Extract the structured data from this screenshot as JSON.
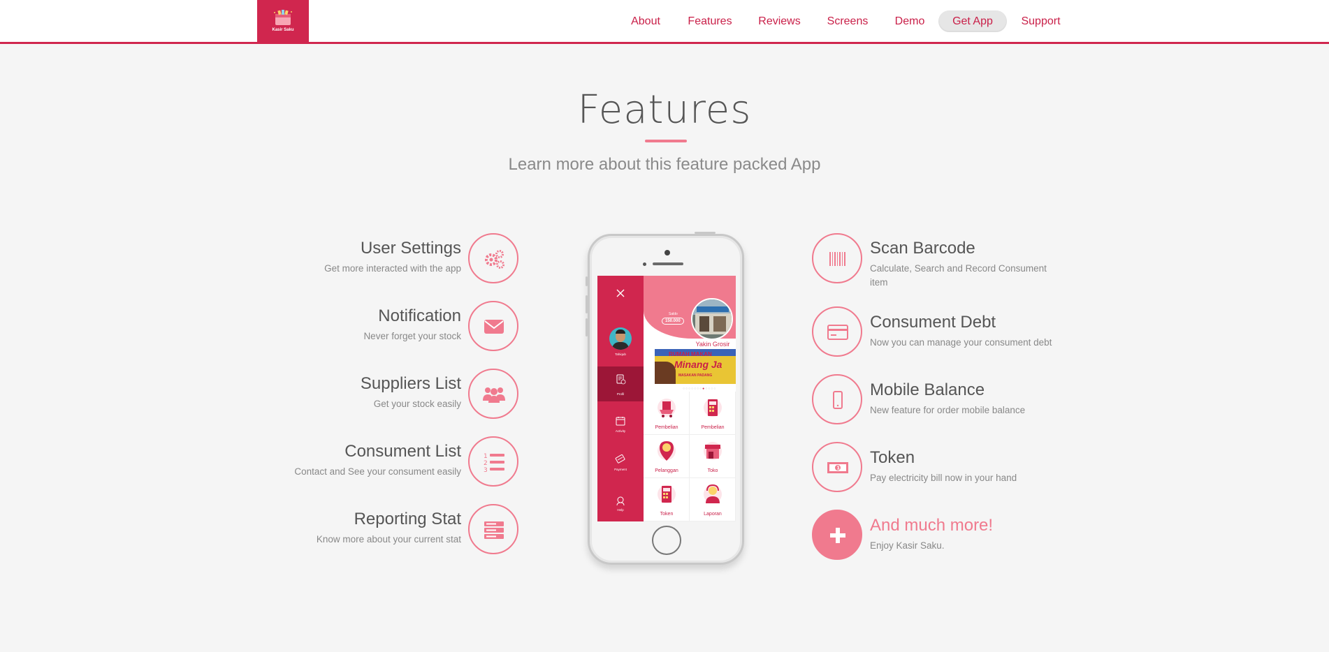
{
  "header": {
    "logo_text": "Kasir Saku",
    "nav": [
      {
        "label": "About"
      },
      {
        "label": "Features"
      },
      {
        "label": "Reviews"
      },
      {
        "label": "Screens"
      },
      {
        "label": "Demo"
      },
      {
        "label": "Get App",
        "active": true
      },
      {
        "label": "Support"
      }
    ]
  },
  "section": {
    "title": "Features",
    "subtitle": "Learn more about this feature packed App"
  },
  "features_left": [
    {
      "title": "User Settings",
      "desc": "Get more interacted with the app",
      "icon": "gears-icon"
    },
    {
      "title": "Notification",
      "desc": "Never forget your stock",
      "icon": "envelope-icon"
    },
    {
      "title": "Suppliers List",
      "desc": "Get your stock easily",
      "icon": "users-icon"
    },
    {
      "title": "Consument List",
      "desc": "Contact and See your consument easily",
      "icon": "numbered-list-icon"
    },
    {
      "title": "Reporting Stat",
      "desc": "Know more about your current stat",
      "icon": "server-icon"
    }
  ],
  "features_right": [
    {
      "title": "Scan Barcode",
      "desc": "Calculate, Search and Record Consument item",
      "icon": "barcode-icon"
    },
    {
      "title": "Consument Debt",
      "desc": "Now you can manage your consument debt",
      "icon": "credit-card-icon"
    },
    {
      "title": "Mobile Balance",
      "desc": "New feature for order mobile balance",
      "icon": "mobile-icon"
    },
    {
      "title": "Token",
      "desc": "Pay electricity bill now in your hand",
      "icon": "money-icon"
    },
    {
      "title": "And much more!",
      "desc": "Enjoy Kasir Saku.",
      "icon": "plus-icon"
    }
  ],
  "phone_screen": {
    "user_name": "Tahiqub",
    "side_items": [
      {
        "label": "Profil",
        "icon": "profile-icon"
      },
      {
        "label": "Activity",
        "icon": "calendar-icon"
      },
      {
        "label": "Payment",
        "icon": "payment-icon"
      },
      {
        "label": "Help",
        "icon": "help-icon"
      }
    ],
    "saldo_label": "Saldo",
    "saldo_value": "150.000",
    "store_name": "Yakin Grosir",
    "banner_line1": "RUMAH MAKAN",
    "banner_line2": "Minang Ja",
    "banner_line3": "MASAKAN PADANG",
    "grid": [
      {
        "label": "Pembelian",
        "icon": "cart-icon"
      },
      {
        "label": "Pembelian",
        "icon": "calculator-icon"
      },
      {
        "label": "Pelanggan",
        "icon": "location-person-icon"
      },
      {
        "label": "Toko",
        "icon": "store-icon"
      },
      {
        "label": "Token",
        "icon": "calculator-icon"
      },
      {
        "label": "Laporan",
        "icon": "customer-service-icon"
      }
    ]
  },
  "colors": {
    "brand": "#d0264e",
    "accent": "#f07a8e",
    "background": "#f5f5f5"
  }
}
